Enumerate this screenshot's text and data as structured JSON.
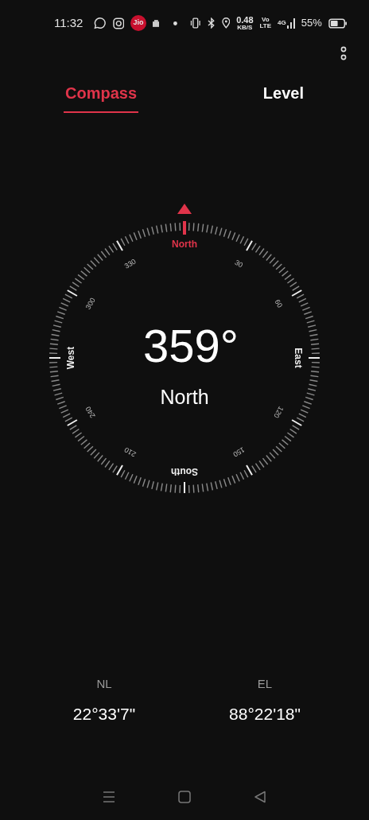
{
  "status_bar": {
    "time": "11:32",
    "jio": "Jio",
    "speed": "0.48",
    "speed_unit": "KB/S",
    "volte_top": "Vo",
    "volte_bottom": "LTE",
    "network": "4G",
    "battery": "55%"
  },
  "tabs": [
    {
      "label": "Compass",
      "selected": true
    },
    {
      "label": "Level",
      "selected": false
    }
  ],
  "dial": {
    "labels": [
      {
        "text": "North",
        "kind": "north"
      },
      {
        "text": "30",
        "kind": "degree"
      },
      {
        "text": "60",
        "kind": "degree"
      },
      {
        "text": "East",
        "kind": "cardinal"
      },
      {
        "text": "120",
        "kind": "degree"
      },
      {
        "text": "150",
        "kind": "degree"
      },
      {
        "text": "South",
        "kind": "cardinal"
      },
      {
        "text": "210",
        "kind": "degree"
      },
      {
        "text": "240",
        "kind": "degree"
      },
      {
        "text": "West",
        "kind": "cardinal"
      },
      {
        "text": "300",
        "kind": "degree"
      },
      {
        "text": "330",
        "kind": "degree"
      }
    ],
    "heading": "359°",
    "direction": "North"
  },
  "coordinates": [
    {
      "label": "NL",
      "value": "22°33'7\""
    },
    {
      "label": "EL",
      "value": "88°22'18\""
    }
  ]
}
